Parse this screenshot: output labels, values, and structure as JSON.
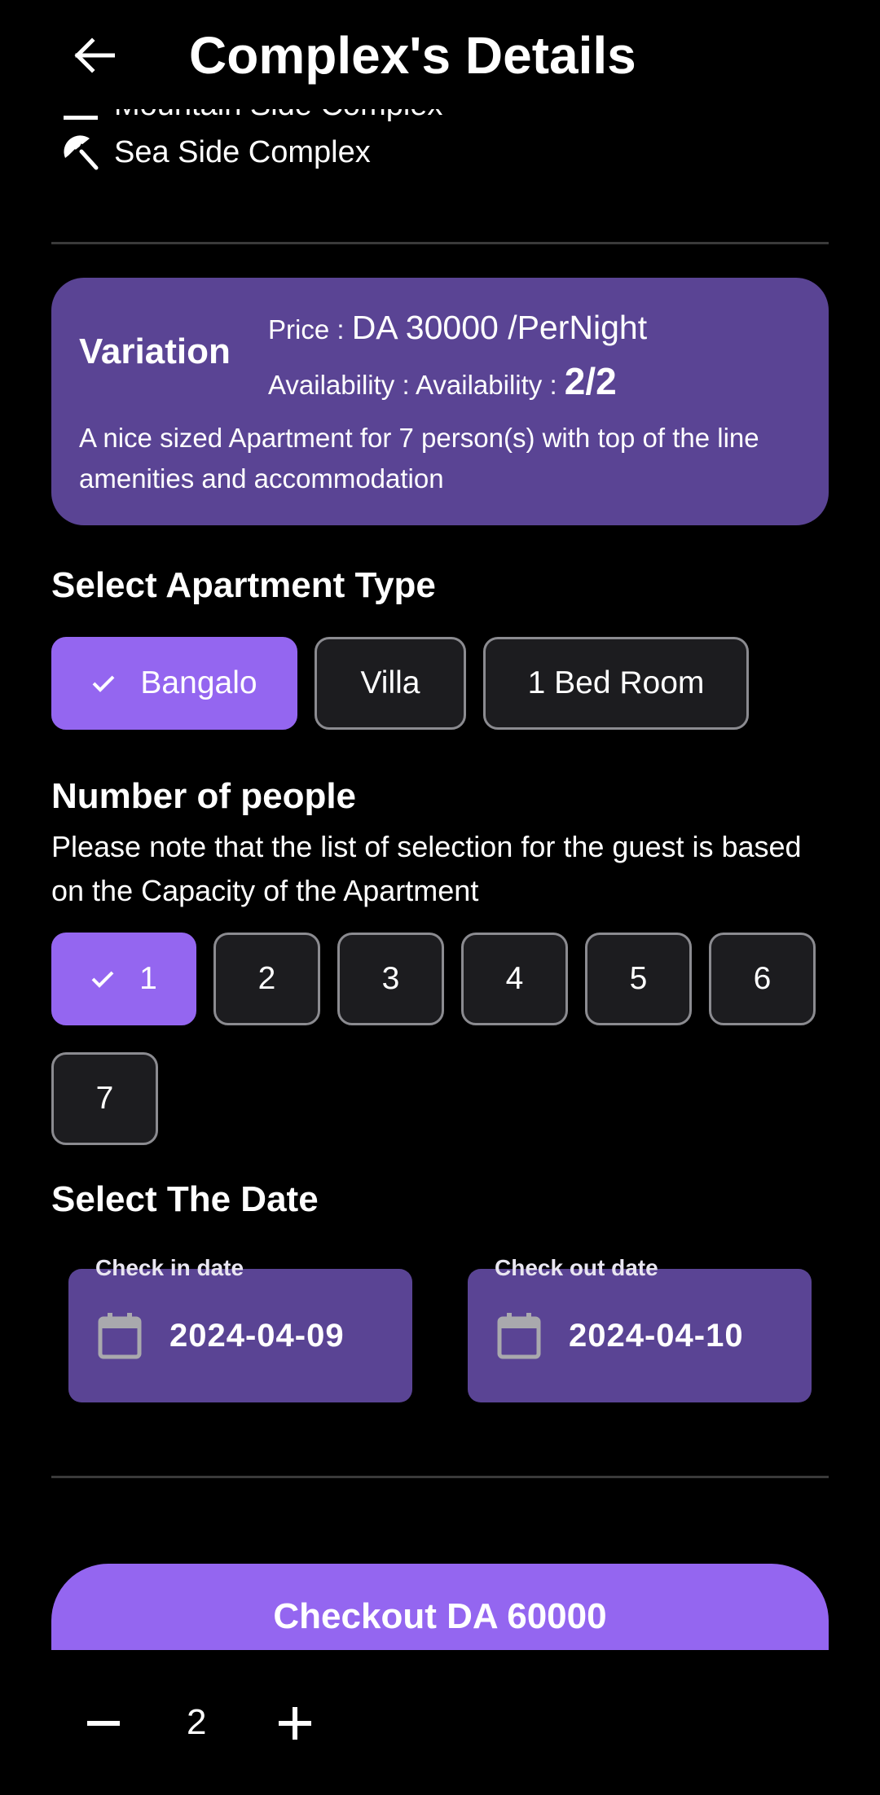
{
  "header": {
    "title": "Complex's Details"
  },
  "complex_tags": [
    {
      "label": "Mountain Side Complex",
      "icon": "mountain-icon"
    },
    {
      "label": "Sea Side Complex",
      "icon": "beach-umbrella-icon"
    }
  ],
  "variation": {
    "title": "Variation",
    "price_prefix": "Price : ",
    "price_value": "DA 30000 /PerNight",
    "availability_prefix": "Availability : Availability : ",
    "availability_value": "2/2",
    "description": "A nice sized Apartment for 7 person(s) with top of the line amenities and accommodation"
  },
  "apartment_type": {
    "title": "Select Apartment Type",
    "options": [
      "Bangalo",
      "Villa",
      "1 Bed Room"
    ],
    "selected": "Bangalo"
  },
  "people": {
    "title": "Number of people",
    "note": "Please note that the list of selection for the guest is based on the Capacity of the Apartment",
    "options": [
      "1",
      "2",
      "3",
      "4",
      "5",
      "6",
      "7"
    ],
    "selected": "1"
  },
  "dates": {
    "title": "Select The Date",
    "check_in_label": "Check in date",
    "check_in_value": "2024-04-09",
    "check_out_label": "Check out date",
    "check_out_value": "2024-04-10"
  },
  "checkout": {
    "label": "Checkout DA 60000"
  },
  "quantity": {
    "value": "2"
  },
  "colors": {
    "background": "#000000",
    "card": "#5a4494",
    "accent": "#9466f0",
    "chip_border": "#8b8b90"
  }
}
